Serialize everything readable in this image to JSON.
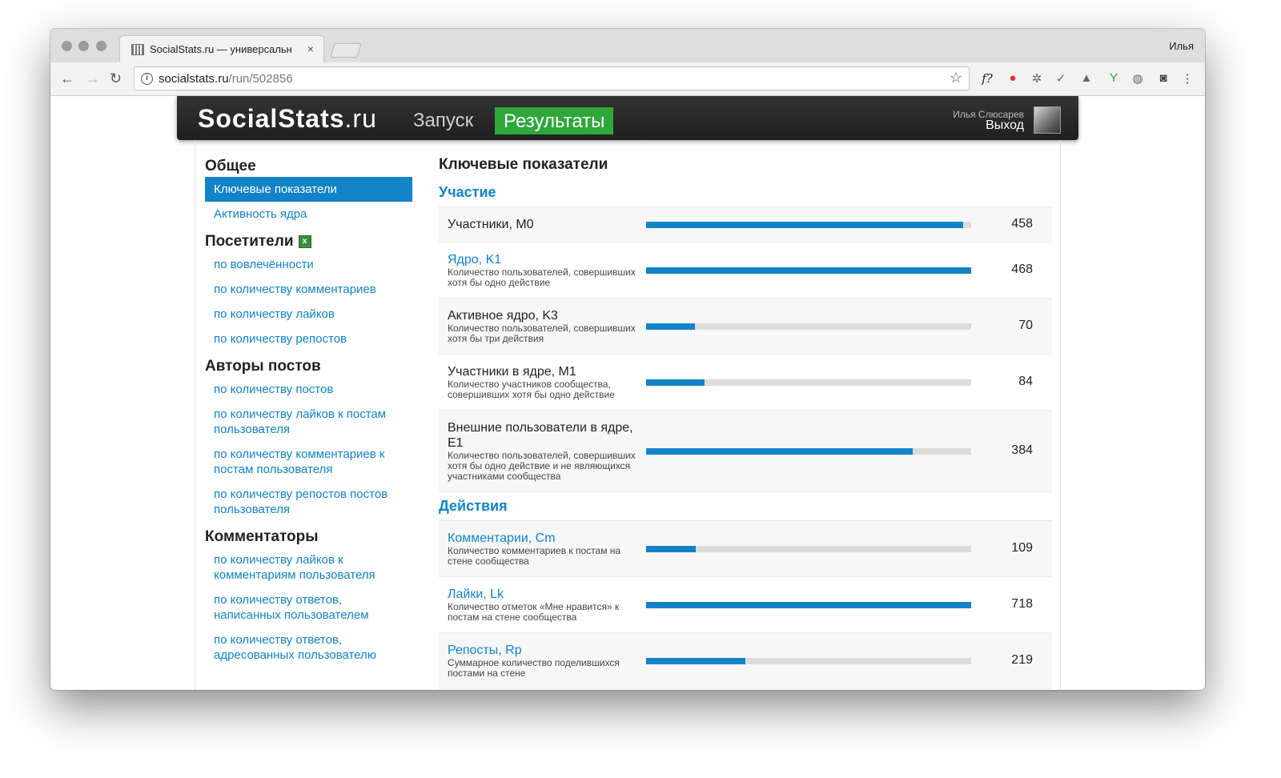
{
  "browser": {
    "tab_title": "SocialStats.ru — универсальн",
    "tab_close": "×",
    "profile_name": "Илья",
    "url_host": "socialstats.ru",
    "url_path": "/run/502856",
    "back_icon": "←",
    "forward_icon": "→",
    "reload_icon": "↻",
    "star_icon": "☆",
    "menu_icon": "⋮",
    "ext_f": "f?"
  },
  "header": {
    "logo_main": "SocialStats",
    "logo_suffix": ".ru",
    "nav_run": "Запуск",
    "nav_results": "Результаты",
    "user_name": "Илья Слюсарев",
    "logout": "Выход"
  },
  "sidebar": {
    "groups": [
      {
        "title": "Общее",
        "items": [
          "Ключевые показатели",
          "Активность ядра"
        ]
      },
      {
        "title": "Посетители",
        "items": [
          "по вовлечённости",
          "по количеству комментариев",
          "по количеству лайков",
          "по количеству репостов"
        ]
      },
      {
        "title": "Авторы постов",
        "items": [
          "по количеству постов",
          "по количеству лайков к постам пользователя",
          "по количеству комментариев к постам пользователя",
          "по количеству репостов постов пользователя"
        ]
      },
      {
        "title": "Комментаторы",
        "items": [
          "по количеству лайков к комментариям пользователя",
          "по количеству ответов, написанных пользователем",
          "по количеству ответов, адресованных пользователю"
        ]
      }
    ]
  },
  "main": {
    "title": "Ключевые показатели",
    "sections": [
      {
        "title": "Участие",
        "metrics": [
          {
            "name": "Участники, M0",
            "desc": "",
            "value": "458",
            "fill": 0.975
          },
          {
            "name": "Ядро, K1",
            "desc": "Количество пользователей, совершивших хотя бы одно действие",
            "value": "468",
            "fill": 1.0
          },
          {
            "name": "Активное ядро, K3",
            "desc": "Количество пользователей, совершивших хотя бы три действия",
            "value": "70",
            "fill": 0.15
          },
          {
            "name": "Участники в ядре, M1",
            "desc": "Количество участников сообщества, совершивших хотя бы одно действие",
            "value": "84",
            "fill": 0.18
          },
          {
            "name": "Внешние пользователи в ядре, E1",
            "desc": "Количество пользователей, совершивших хотя бы одно действие и не являющихся участниками сообщества",
            "value": "384",
            "fill": 0.82
          }
        ]
      },
      {
        "title": "Действия",
        "metrics": [
          {
            "name": "Комментарии, Cm",
            "desc": "Количество комментариев к постам на стене сообщества",
            "value": "109",
            "fill": 0.152
          },
          {
            "name": "Лайки, Lk",
            "desc": "Количество отметок «Мне нравится» к постам на стене сообщества",
            "value": "718",
            "fill": 1.0
          },
          {
            "name": "Репосты, Rp",
            "desc": "Суммарное количество поделившихся постами на стене",
            "value": "219",
            "fill": 0.305
          }
        ]
      }
    ]
  }
}
